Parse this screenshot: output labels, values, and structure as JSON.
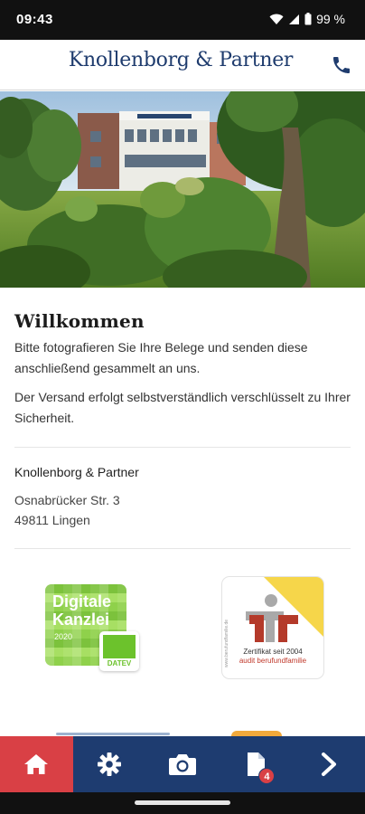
{
  "status_bar": {
    "time": "09:43",
    "battery": "99 %"
  },
  "header": {
    "brand": "Knollenborg & Partner",
    "phone_icon": "phone-icon"
  },
  "welcome": {
    "title": "Willkommen",
    "paragraph1": "Bitte fotografieren Sie Ihre Belege und senden diese anschließend gesammelt an uns.",
    "paragraph2": "Der Versand erfolgt selbstverständlich verschlüsselt zu Ihrer Sicherheit."
  },
  "address": {
    "company": "Knollenborg & Partner",
    "street": "Osnabrücker Str. 3",
    "city": "49811 Lingen"
  },
  "logos": {
    "datev_line1": "Digitale",
    "datev_line2": "Kanzlei",
    "datev_year": "2020",
    "datev_mark": "DATEV",
    "audit_caption1": "Zertifikat seit 2004",
    "audit_caption2": "audit berufundfamilie",
    "audit_side": "www.berufundfamilie.de"
  },
  "nav": {
    "items": [
      {
        "icon": "home-icon",
        "active": true
      },
      {
        "icon": "gear-icon",
        "active": false
      },
      {
        "icon": "camera-icon",
        "active": false
      },
      {
        "icon": "document-icon",
        "badge": "4",
        "active": false
      },
      {
        "icon": "chevron-right-icon",
        "active": false
      }
    ]
  },
  "colors": {
    "nav_bg": "#1e3c70",
    "nav_active": "#d94045",
    "brand": "#1f3c6e"
  }
}
